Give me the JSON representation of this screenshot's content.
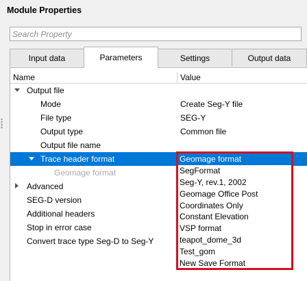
{
  "window": {
    "title": "Module Properties"
  },
  "search": {
    "placeholder": "Search Property"
  },
  "tabs": [
    {
      "label": "Input data"
    },
    {
      "label": "Parameters"
    },
    {
      "label": "Settings"
    },
    {
      "label": "Output data"
    }
  ],
  "columns": {
    "name": "Name",
    "value": "Value"
  },
  "tree": {
    "output_file": "Output file",
    "mode": {
      "name": "Mode",
      "value": "Create Seg-Y file"
    },
    "file_type": {
      "name": "File type",
      "value": "SEG-Y"
    },
    "output_type": {
      "name": "Output type",
      "value": "Common file"
    },
    "output_file_name": {
      "name": "Output file name",
      "value": ""
    },
    "trace_header_format": {
      "name": "Trace header format"
    },
    "geomage_format_sub": "Geomage format",
    "advanced": "Advanced",
    "segd_version": "SEG-D version",
    "additional_headers": "Additional headers",
    "stop_in_error_case": "Stop in error case",
    "convert_trace_type": "Convert trace type Seg-D to Seg-Y"
  },
  "dropdown": {
    "options": [
      "Geomage format",
      "SegFormat",
      "Seg-Y, rev.1, 2002",
      "Geomage Office Post",
      "Coordinates Only",
      "Constant Elevation",
      "VSP format",
      "teapot_dome_3d",
      "Test_gom",
      "New Save Format"
    ],
    "selected": "Geomage format"
  },
  "colors": {
    "selection": "#0078d7",
    "highlight_border": "#d3121e"
  }
}
